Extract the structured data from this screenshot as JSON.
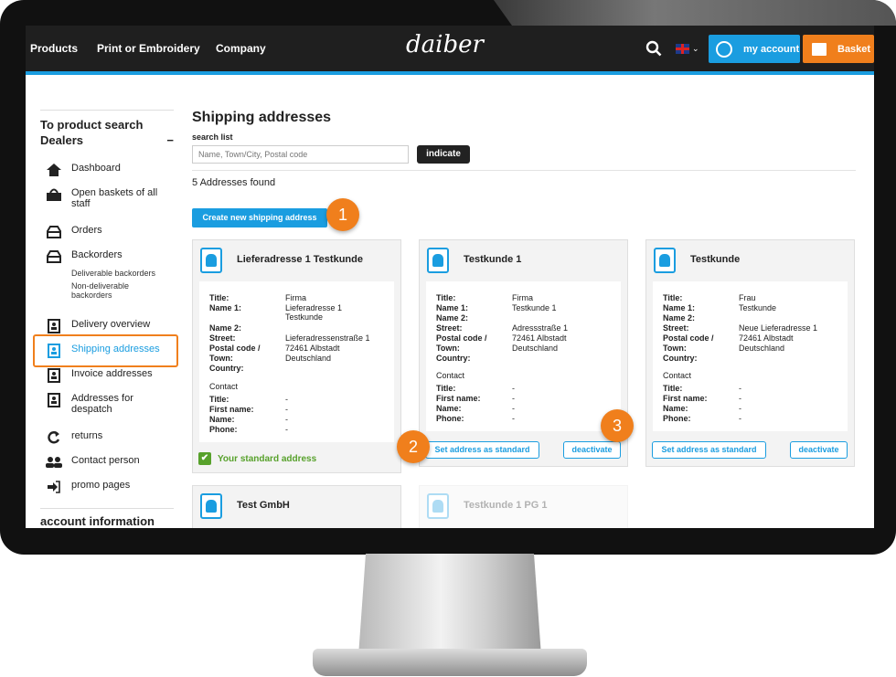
{
  "header": {
    "nav": [
      "Products",
      "Print or Embroidery",
      "Company"
    ],
    "logo": "daiber",
    "account_label": "my account",
    "basket_label": "Basket",
    "accent_color": "#1a9de0",
    "basket_color": "#f07f1c"
  },
  "sidebar": {
    "product_search": "To product search",
    "dealers": "Dealers",
    "collapse": "−",
    "items": [
      {
        "label": "Dashboard",
        "icon": "home-icon"
      },
      {
        "label": "Open baskets of all staff",
        "icon": "basket-icon"
      },
      {
        "label": "Orders",
        "icon": "inbox-icon"
      },
      {
        "label": "Backorders",
        "icon": "inbox-icon"
      },
      {
        "label": "Delivery overview",
        "icon": "contact-book-icon"
      },
      {
        "label": "Shipping addresses",
        "icon": "contact-book-icon"
      },
      {
        "label": "Invoice addresses",
        "icon": "contact-book-icon"
      },
      {
        "label": "Addresses for despatch",
        "icon": "contact-book-icon"
      },
      {
        "label": "returns",
        "icon": "return-icon"
      },
      {
        "label": "Contact person",
        "icon": "people-icon"
      },
      {
        "label": "promo pages",
        "icon": "login-icon"
      }
    ],
    "backorder_sub": [
      "Deliverable backorders",
      "Non-deliverable backorders"
    ],
    "account_info": "account information"
  },
  "main": {
    "title": "Shipping addresses",
    "search_label": "search list",
    "search_placeholder": "Name, Town/City, Postal code",
    "search_button": "indicate",
    "found": "5 Addresses found",
    "create_button": "Create new shipping address"
  },
  "labels": {
    "title": "Title:",
    "name1": "Name 1:",
    "name2": "Name 2:",
    "street": "Street:",
    "postal": "Postal code /",
    "town": "Town:",
    "country": "Country:",
    "contact": "Contact",
    "first": "First name:",
    "name": "Name:",
    "phone": "Phone:"
  },
  "cards": [
    {
      "name": "Lieferadresse 1 Testkunde",
      "title": "Firma",
      "name1": "Lieferadresse 1 Testkunde",
      "name2": "",
      "street": "Lieferadressenstraße 1",
      "postal_town": "72461 Albstadt",
      "country": "Deutschland",
      "c_title": "-",
      "c_first": "-",
      "c_name": "-",
      "c_phone": "-",
      "standard": "Your standard address"
    },
    {
      "name": "Testkunde 1",
      "title": "Firma",
      "name1": "Testkunde 1",
      "name2": "",
      "street": "Adressstraße 1",
      "postal_town": "72461 Albstadt",
      "country": "Deutschland",
      "c_title": "-",
      "c_first": "-",
      "c_name": "-",
      "c_phone": "-",
      "set_standard": "Set address as standard",
      "deactivate": "deactivate"
    },
    {
      "name": "Testkunde",
      "title": "Frau",
      "name1": "Testkunde",
      "name2": "",
      "street": "Neue Lieferadresse 1",
      "postal_town": "72461 Albstadt",
      "country": "Deutschland",
      "c_title": "-",
      "c_first": "-",
      "c_name": "-",
      "c_phone": "-",
      "set_standard": "Set address as standard",
      "deactivate": "deactivate"
    },
    {
      "name": "Test GmbH"
    },
    {
      "name": "Testkunde 1 PG 1"
    }
  ],
  "badges": [
    "1",
    "2",
    "3"
  ]
}
